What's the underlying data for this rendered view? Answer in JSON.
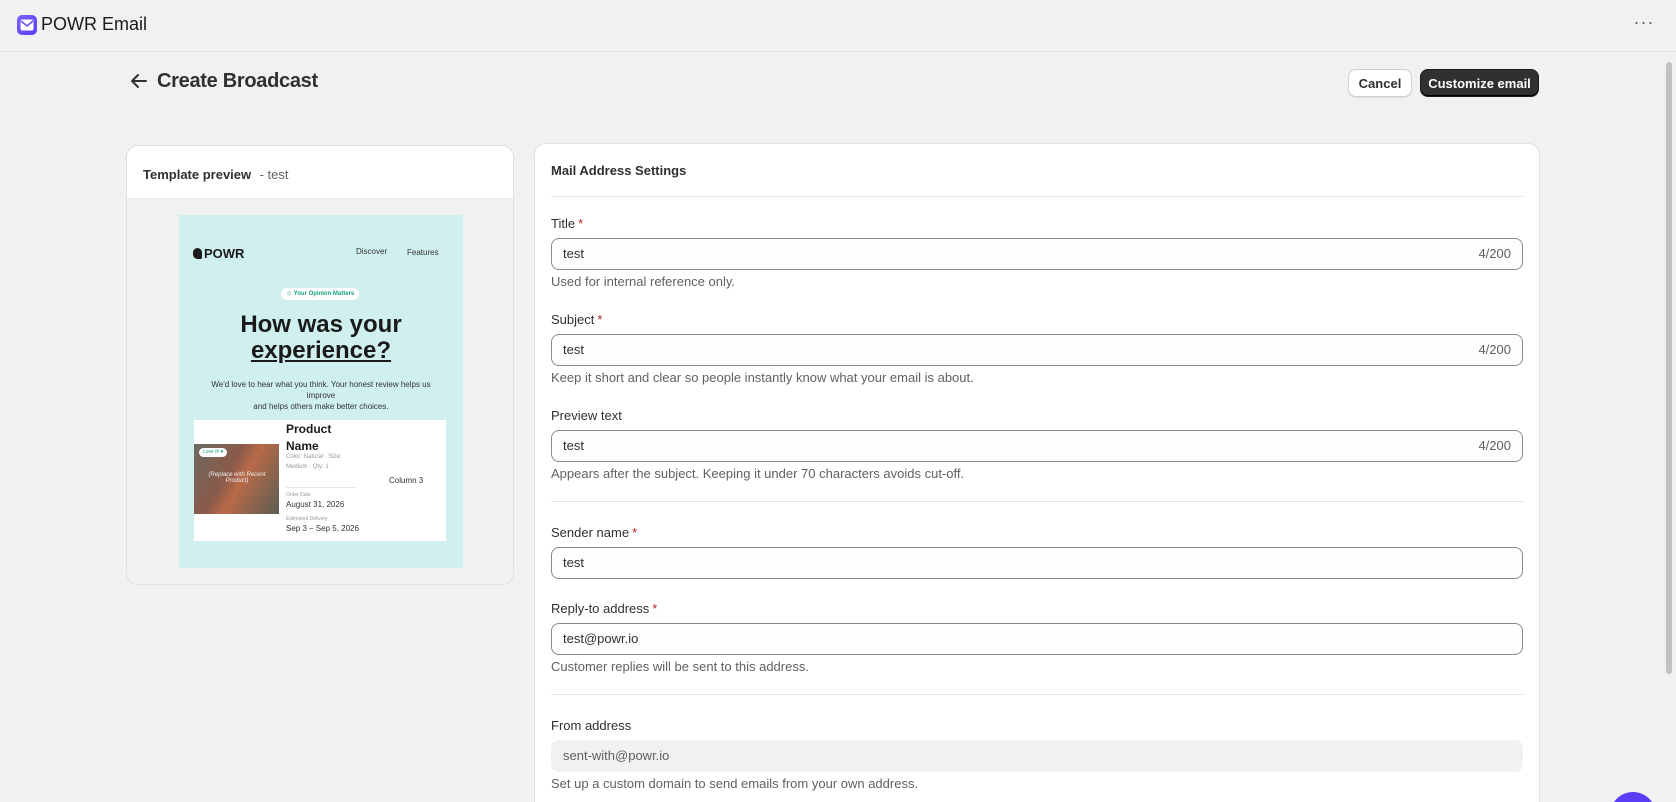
{
  "app": {
    "title": "POWR Email",
    "more_label": "···"
  },
  "header": {
    "title": "Create Broadcast",
    "cancel_label": "Cancel",
    "customize_label": "Customize email"
  },
  "preview": {
    "label": "Template preview",
    "subtitle": "- test",
    "email": {
      "logo": "POWR",
      "nav": [
        "Discover",
        "Features"
      ],
      "pill": "☺ Your Opinion Matters",
      "heading_line1": "How was your",
      "heading_line2": "experience?",
      "copy_line1": "We'd love to hear what you think. Your honest review helps us improve",
      "copy_line2": "and helps others make better choices.",
      "product": {
        "badge": "Love it! ♥",
        "image_caption": "(Replace with Recent Product)",
        "name_line1": "Product",
        "name_line2": "Name",
        "meta_line1": "Color: Natural · Size:",
        "meta_line2": "Medium · Qty: 1",
        "column3": "Column 3",
        "order_date_label": "Order Date",
        "order_date": "August 31, 2026",
        "delivery_label": "Estimated Delivery",
        "delivery": "Sep 3 – Sep 5, 2026"
      }
    }
  },
  "settings": {
    "title": "Mail Address Settings",
    "title_field": {
      "label": "Title",
      "required": "*",
      "value": "test",
      "counter": "4/200",
      "help": "Used for internal reference only."
    },
    "subject_field": {
      "label": "Subject",
      "required": "*",
      "value": "test",
      "counter": "4/200",
      "help": "Keep it short and clear so people instantly know what your email is about."
    },
    "preview_field": {
      "label": "Preview text",
      "value": "test",
      "counter": "4/200",
      "help": "Appears after the subject. Keeping it under 70 characters avoids cut-off."
    },
    "sender_field": {
      "label": "Sender name",
      "required": "*",
      "value": "test"
    },
    "reply_field": {
      "label": "Reply-to address",
      "required": "*",
      "value": "test@powr.io",
      "help": "Customer replies will be sent to this address."
    },
    "from_field": {
      "label": "From address",
      "value": "sent-with@powr.io",
      "help": "Set up a custom domain to send emails from your own address."
    }
  },
  "colors": {
    "accent": "#5b3df5",
    "primary_button": "#303030",
    "required": "#b3261e",
    "email_bg": "#cff0ee"
  }
}
